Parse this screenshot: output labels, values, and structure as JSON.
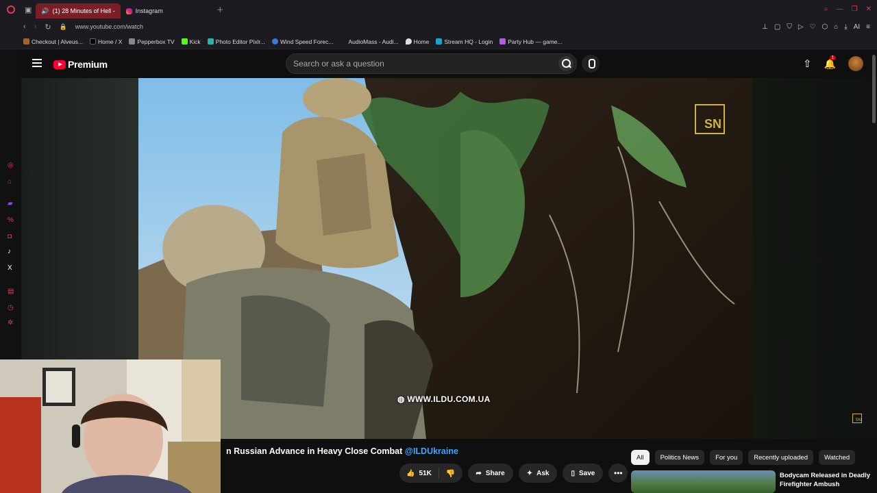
{
  "browser": {
    "tabs": [
      {
        "label": "(1) 28 Minutes of Hell -",
        "active": true
      },
      {
        "label": "Instagram",
        "active": false
      }
    ],
    "url": "www.youtube.com/watch",
    "bookmarks": [
      "Checkout | Alveus...",
      "Home / X",
      "Pepperbox TV",
      "Kick",
      "Photo Editor Pixlr...",
      "Wind Speed Forec...",
      "AudioMass - Audi...",
      "Home",
      "Stream HQ - Login",
      "Party Hub — game..."
    ],
    "ai_label": "AI"
  },
  "youtube": {
    "logo_text": "Premium",
    "search_placeholder": "Search or ask a question",
    "notification_count": "1",
    "video_watermark": "WWW.ILDU.COM.UA",
    "logo_badge": "SN",
    "video_title_partial": "n Russian Advance in Heavy Close Combat",
    "channel_tag": "@ILDUkraine",
    "likes": "51K",
    "actions": {
      "share": "Share",
      "ask": "Ask",
      "save": "Save"
    },
    "chips": [
      "All",
      "Politics News",
      "For you",
      "Recently uploaded",
      "Watched"
    ],
    "recommendation_title": "Bodycam Released in Deadly Firefighter Ambush"
  }
}
